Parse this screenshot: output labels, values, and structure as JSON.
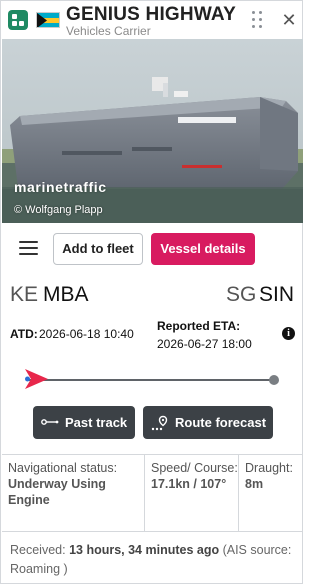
{
  "header": {
    "vessel_name": "GENIUS HIGHWAY",
    "vessel_type": "Vehicles Carrier",
    "flag": "bahamas-flag-icon"
  },
  "photo": {
    "watermark": "marinetraffic",
    "credit": "© Wolfgang Plapp"
  },
  "actions": {
    "add_to_fleet": "Add to fleet",
    "vessel_details": "Vessel details",
    "accent_color": "#d81b60"
  },
  "route": {
    "departure": {
      "country": "KE",
      "port": "MBA"
    },
    "arrival": {
      "country": "SG",
      "port": "SIN"
    },
    "atd_label": "ATD:",
    "atd_value": "2026-06-18 10:40",
    "eta_label": "Reported ETA:",
    "eta_value": "2026-06-27 18:00",
    "progress_fraction": 0.0
  },
  "buttons": {
    "past_track": "Past track",
    "route_forecast": "Route forecast"
  },
  "status": {
    "nav_label": "Navigational status:",
    "nav_value": "Underway Using Engine",
    "speed_label": "Speed/ Course:",
    "speed_value": "17.1kn / 107°",
    "draught_label": "Draught:",
    "draught_value": "8m"
  },
  "received": {
    "prefix": "Received: ",
    "age": "13 hours, 34 minutes ago",
    "suffix": " (AIS source: Roaming )"
  }
}
